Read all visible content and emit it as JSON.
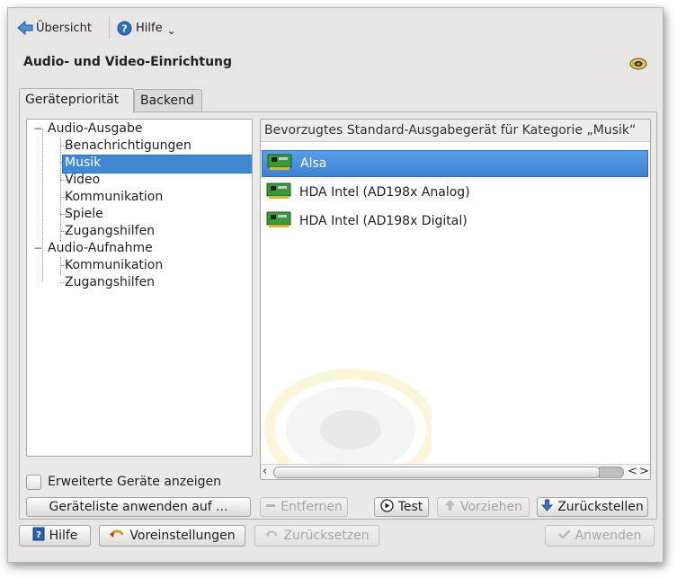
{
  "toolbar": {
    "overview_label": "Übersicht",
    "help_label": "Hilfe",
    "help_menu_arrow": "⌄"
  },
  "page": {
    "title": "Audio- und Video-Einrichtung"
  },
  "tabs": [
    {
      "label": "Gerätepriorität",
      "active": true
    },
    {
      "label": "Backend",
      "active": false
    }
  ],
  "tree": {
    "expander_symbol": "−",
    "groups": [
      {
        "label": "Audio-Ausgabe",
        "children": [
          "Benachrichtigungen",
          "Musik",
          "Video",
          "Kommunikation",
          "Spiele",
          "Zugangshilfen"
        ]
      },
      {
        "label": "Audio-Aufnahme",
        "children": [
          "Kommunikation",
          "Zugangshilfen"
        ]
      }
    ],
    "selected": "Musik"
  },
  "devices": {
    "header": "Bevorzugtes Standard-Ausgabegerät für Kategorie „Musik“",
    "items": [
      {
        "label": "Alsa",
        "selected": true
      },
      {
        "label": "HDA Intel (AD198x Analog)",
        "selected": false
      },
      {
        "label": "HDA Intel (AD198x Digital)",
        "selected": false
      }
    ],
    "scroll_left": "‹",
    "scroll_right_a": "<",
    "scroll_right_b": ">"
  },
  "options": {
    "advanced_devices_label": "Erweiterte Geräte anzeigen",
    "advanced_devices_checked": false,
    "apply_list_label": "Geräteliste anwenden auf ..."
  },
  "device_actions": {
    "remove_label": "Entfernen",
    "test_label": "Test",
    "prefer_label": "Vorziehen",
    "defer_label": "Zurückstellen"
  },
  "footer": {
    "help_label": "Hilfe",
    "defaults_label": "Voreinstellungen",
    "reset_label": "Zurücksetzen",
    "apply_label": "Anwenden"
  },
  "colors": {
    "selection": "#3f88d2",
    "window_bg": "#e7e6e5",
    "disabled_text": "#a8a6a4"
  },
  "icons": {
    "back": "arrow-left-icon",
    "help": "help-circle-icon",
    "speaker": "speaker-icon",
    "sound_card": "sound-card-icon",
    "play": "play-icon",
    "up": "arrow-up-icon",
    "down": "arrow-down-icon",
    "minus": "minus-icon",
    "help_book": "help-book-icon",
    "defaults": "defaults-icon",
    "undo": "undo-icon",
    "check": "checkmark-icon"
  }
}
